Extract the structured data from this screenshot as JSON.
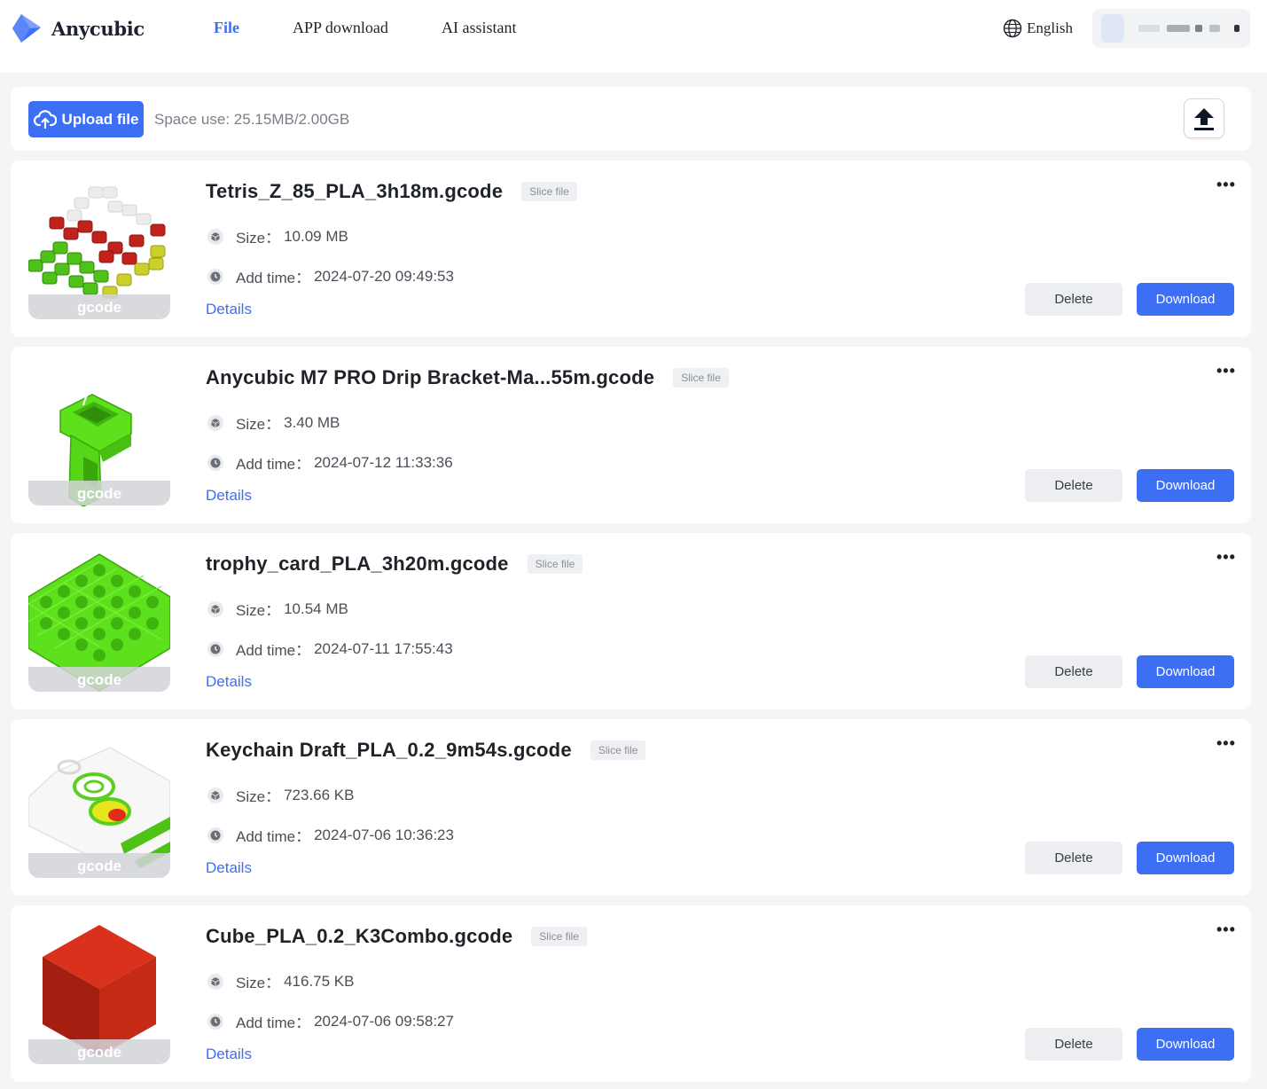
{
  "brand": {
    "name": "Anycubic"
  },
  "nav": {
    "items": [
      {
        "label": "File"
      },
      {
        "label": "APP download"
      },
      {
        "label": "AI assistant"
      }
    ]
  },
  "header": {
    "language": "English"
  },
  "upload": {
    "button_label": "Upload file",
    "space_label": "Space use:",
    "space_value": "25.15MB/2.00GB"
  },
  "colors": {
    "accent": "#3d6ff5"
  },
  "files": [
    {
      "name": "Tetris_Z_85_PLA_3h18m.gcode",
      "tag": "Slice file",
      "size_label": "Size：",
      "size": "10.09 MB",
      "time_label": "Add time：",
      "time": "2024-07-20 09:49:53",
      "thumb_label": "gcode",
      "details": "Details",
      "delete": "Delete",
      "download": "Download",
      "more": "•••"
    },
    {
      "name": "Anycubic M7 PRO Drip Bracket-Ma...55m.gcode",
      "tag": "Slice file",
      "size_label": "Size：",
      "size": "3.40 MB",
      "time_label": "Add time：",
      "time": "2024-07-12 11:33:36",
      "thumb_label": "gcode",
      "details": "Details",
      "delete": "Delete",
      "download": "Download",
      "more": "•••"
    },
    {
      "name": "trophy_card_PLA_3h20m.gcode",
      "tag": "Slice file",
      "size_label": "Size：",
      "size": "10.54 MB",
      "time_label": "Add time：",
      "time": "2024-07-11 17:55:43",
      "thumb_label": "gcode",
      "details": "Details",
      "delete": "Delete",
      "download": "Download",
      "more": "•••"
    },
    {
      "name": "Keychain Draft_PLA_0.2_9m54s.gcode",
      "tag": "Slice file",
      "size_label": "Size：",
      "size": "723.66 KB",
      "time_label": "Add time：",
      "time": "2024-07-06 10:36:23",
      "thumb_label": "gcode",
      "details": "Details",
      "delete": "Delete",
      "download": "Download",
      "more": "•••"
    },
    {
      "name": "Cube_PLA_0.2_K3Combo.gcode",
      "tag": "Slice file",
      "size_label": "Size：",
      "size": "416.75 KB",
      "time_label": "Add time：",
      "time": "2024-07-06 09:58:27",
      "thumb_label": "gcode",
      "details": "Details",
      "delete": "Delete",
      "download": "Download",
      "more": "•••"
    }
  ]
}
